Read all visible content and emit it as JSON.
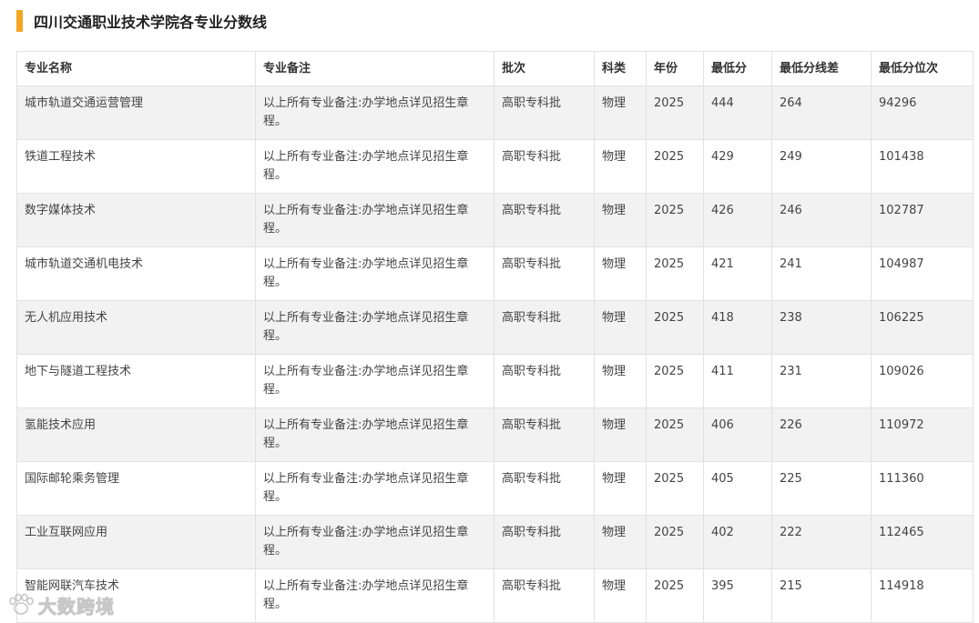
{
  "page": {
    "title": "四川交通职业技术学院各专业分数线"
  },
  "table": {
    "headers": [
      "专业名称",
      "专业备注",
      "批次",
      "科类",
      "年份",
      "最低分",
      "最低分线差",
      "最低分位次"
    ],
    "rows": [
      [
        "城市轨道交通运营管理",
        "以上所有专业备注:办学地点详见招生章程。",
        "高职专科批",
        "物理",
        "2025",
        "444",
        "264",
        "94296"
      ],
      [
        "铁道工程技术",
        "以上所有专业备注:办学地点详见招生章程。",
        "高职专科批",
        "物理",
        "2025",
        "429",
        "249",
        "101438"
      ],
      [
        "数字媒体技术",
        "以上所有专业备注:办学地点详见招生章程。",
        "高职专科批",
        "物理",
        "2025",
        "426",
        "246",
        "102787"
      ],
      [
        "城市轨道交通机电技术",
        "以上所有专业备注:办学地点详见招生章程。",
        "高职专科批",
        "物理",
        "2025",
        "421",
        "241",
        "104987"
      ],
      [
        "无人机应用技术",
        "以上所有专业备注:办学地点详见招生章程。",
        "高职专科批",
        "物理",
        "2025",
        "418",
        "238",
        "106225"
      ],
      [
        "地下与隧道工程技术",
        "以上所有专业备注:办学地点详见招生章程。",
        "高职专科批",
        "物理",
        "2025",
        "411",
        "231",
        "109026"
      ],
      [
        "氢能技术应用",
        "以上所有专业备注:办学地点详见招生章程。",
        "高职专科批",
        "物理",
        "2025",
        "406",
        "226",
        "110972"
      ],
      [
        "国际邮轮乘务管理",
        "以上所有专业备注:办学地点详见招生章程。",
        "高职专科批",
        "物理",
        "2025",
        "405",
        "225",
        "111360"
      ],
      [
        "工业互联网应用",
        "以上所有专业备注:办学地点详见招生章程。",
        "高职专科批",
        "物理",
        "2025",
        "402",
        "222",
        "112465"
      ],
      [
        "智能网联汽车技术",
        "以上所有专业备注:办学地点详见招生章程。",
        "高职专科批",
        "物理",
        "2025",
        "395",
        "215",
        "114918"
      ]
    ]
  },
  "watermark": {
    "text": "大数跨境",
    "icon": "paw-logo-icon"
  },
  "colors": {
    "accent": "#f5a623",
    "row_stripe": "#f2f2f2",
    "border": "#e2e2e2"
  }
}
